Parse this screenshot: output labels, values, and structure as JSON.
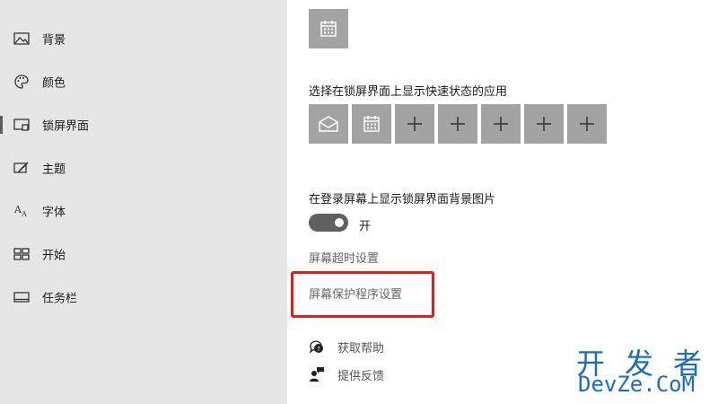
{
  "sidebar": {
    "items": [
      {
        "label": "背景",
        "icon": "picture-icon"
      },
      {
        "label": "颜色",
        "icon": "palette-icon"
      },
      {
        "label": "锁屏界面",
        "icon": "lock-screen-icon",
        "selected": true
      },
      {
        "label": "主题",
        "icon": "theme-brush-icon"
      },
      {
        "label": "字体",
        "icon": "font-icon"
      },
      {
        "label": "开始",
        "icon": "start-tiles-icon"
      },
      {
        "label": "任务栏",
        "icon": "taskbar-icon"
      }
    ]
  },
  "main": {
    "detail_app_icon": "calendar-icon",
    "quick_status": {
      "label": "选择在锁屏界面上显示快速状态的应用",
      "apps": [
        {
          "icon": "mail-icon"
        },
        {
          "icon": "calendar-icon"
        },
        {
          "icon": "plus-icon"
        },
        {
          "icon": "plus-icon"
        },
        {
          "icon": "plus-icon"
        },
        {
          "icon": "plus-icon"
        },
        {
          "icon": "plus-icon"
        }
      ]
    },
    "signin_background": {
      "label": "在登录屏幕上显示锁屏界面背景图片",
      "toggle_state": "开",
      "toggle_on": true
    },
    "links": {
      "screen_timeout": "屏幕超时设置",
      "screen_saver": "屏幕保护程序设置"
    },
    "help": {
      "get_help": "获取帮助",
      "give_feedback": "提供反馈"
    }
  },
  "watermark": {
    "top": "开发者",
    "bottom": "DevZe.CoM"
  },
  "colors": {
    "sidebar_bg": "#e6e6e6",
    "tile_bg": "#a3a3a3",
    "toggle_on": "#616161",
    "highlight_border": "#e41b1b",
    "watermark": "#1b6cc4"
  }
}
